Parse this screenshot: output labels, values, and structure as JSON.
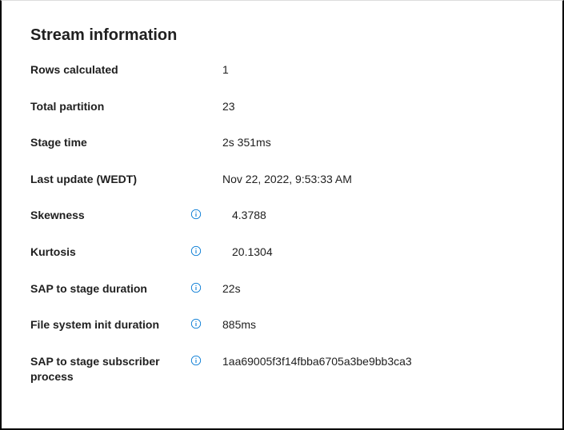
{
  "title": "Stream information",
  "rows": {
    "rows_calculated": {
      "label": "Rows calculated",
      "value": "1"
    },
    "total_partition": {
      "label": "Total partition",
      "value": "23"
    },
    "stage_time": {
      "label": "Stage time",
      "value": "2s 351ms"
    },
    "last_update": {
      "label": "Last update (WEDT)",
      "value": "Nov 22, 2022, 9:53:33 AM"
    },
    "skewness": {
      "label": "Skewness",
      "value": "4.3788"
    },
    "kurtosis": {
      "label": "Kurtosis",
      "value": "20.1304"
    },
    "sap_stage_duration": {
      "label": "SAP to stage duration",
      "value": "22s"
    },
    "fs_init_duration": {
      "label": "File system init duration",
      "value": "885ms"
    },
    "sap_subscriber_process": {
      "label": "SAP to stage subscriber process",
      "value": "1aa69005f3f14fbba6705a3be9bb3ca3"
    }
  }
}
